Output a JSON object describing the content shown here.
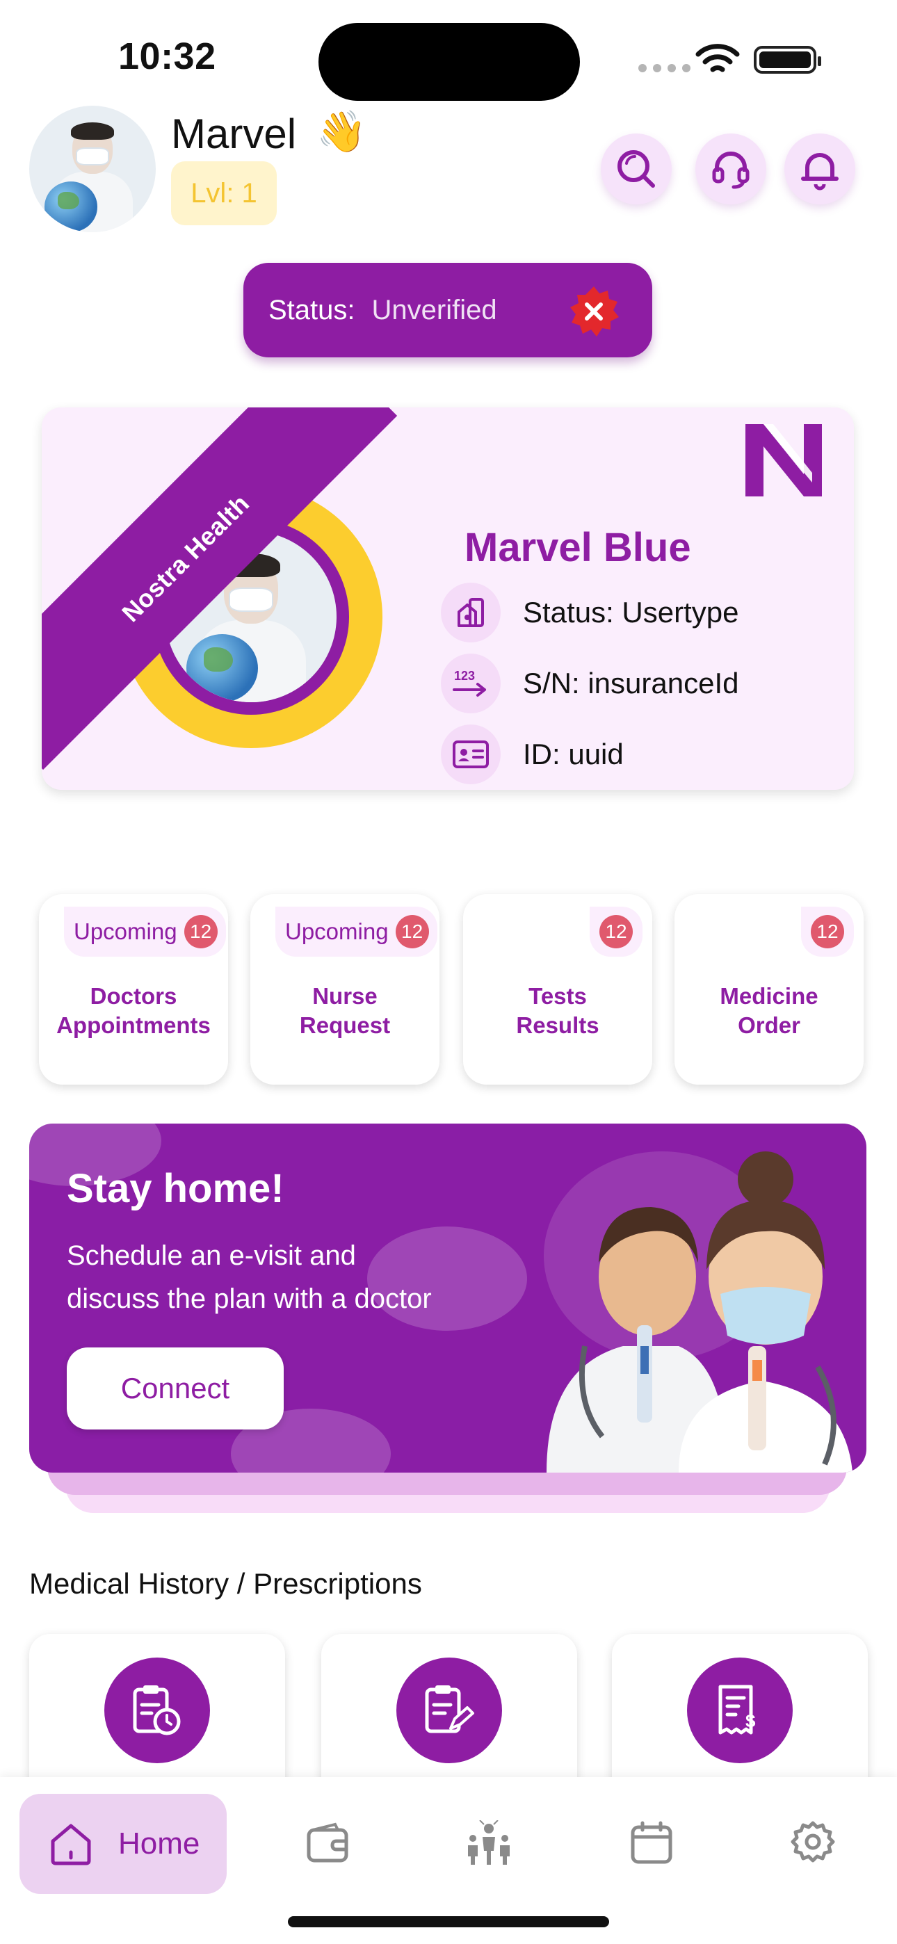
{
  "status_bar": {
    "time": "10:32"
  },
  "header": {
    "name": "Marvel",
    "wave": "👋",
    "level": "Lvl: 1"
  },
  "status": {
    "label": "Status:",
    "value": "Unverified"
  },
  "card": {
    "brand": "Nostra Health",
    "name": "Marvel Blue",
    "rows": [
      {
        "icon": "user-type-icon",
        "text": "Status: Usertype"
      },
      {
        "icon": "serial-number-icon",
        "text": "S/N: insuranceId"
      },
      {
        "icon": "id-card-icon",
        "text": "ID: uuid"
      }
    ]
  },
  "tiles": [
    {
      "chip": "Upcoming",
      "count": "12",
      "line1": "Doctors",
      "line2": "Appointments"
    },
    {
      "chip": "Upcoming",
      "count": "12",
      "line1": "Nurse",
      "line2": "Request"
    },
    {
      "chip": "",
      "count": "12",
      "line1": "Tests",
      "line2": "Results"
    },
    {
      "chip": "",
      "count": "12",
      "line1": "Medicine",
      "line2": "Order"
    }
  ],
  "promo": {
    "title": "Stay home!",
    "line1": "Schedule an e-visit and",
    "line2": "discuss the plan with a doctor",
    "button": "Connect"
  },
  "history": {
    "title": "Medical History / Prescriptions",
    "items": [
      "clipboard-clock-icon",
      "clipboard-edit-icon",
      "receipt-dollar-icon"
    ]
  },
  "nav": {
    "home": "Home",
    "items": [
      "home-icon",
      "wallet-icon",
      "family-icon",
      "calendar-icon",
      "settings-icon"
    ]
  },
  "colors": {
    "brand": "#8e1da3",
    "accent_yellow": "#fccd2e",
    "badge_red": "#e0596d"
  }
}
